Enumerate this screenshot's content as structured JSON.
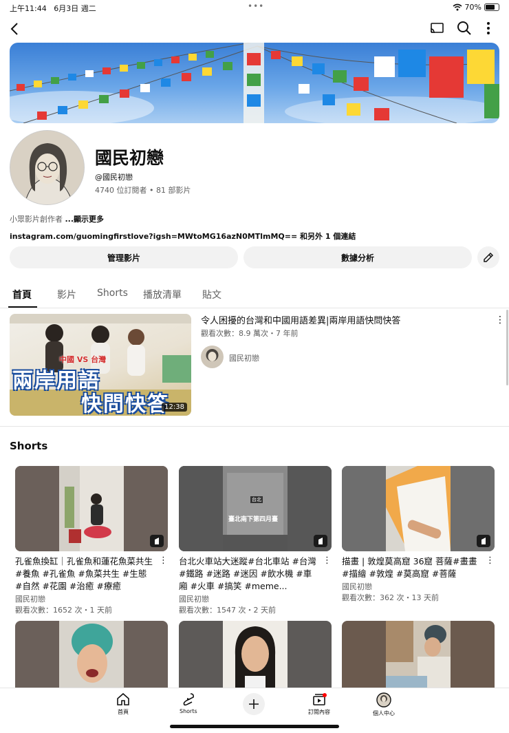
{
  "status": {
    "time": "上午11:44",
    "date": "6月3日 週二",
    "dots": "•••",
    "battery": "70%",
    "battery_level": 0.7
  },
  "channel": {
    "name": "國民初戀",
    "handle": "@國民初戀",
    "stats": "4740 位訂閱者 • 81 部影片",
    "description": "小眾影片創作者",
    "show_more": "...顯示更多",
    "link": "instagram.com/guomingfirstlove?igsh=MWtoMG16azN0MTlmMQ== 和另外 1 個連結"
  },
  "buttons": {
    "manage": "管理影片",
    "analytics": "數據分析"
  },
  "tabs": [
    "首頁",
    "影片",
    "Shorts",
    "播放清單",
    "貼文"
  ],
  "featured": {
    "title": "令人困擾的台灣和中國用語差異|兩岸用語快問快答",
    "meta": "觀看次數：8.9 萬次・7 年前",
    "channel": "國民初戀",
    "duration": "12:38",
    "thumb_text_top": "中國 VS 台灣",
    "thumb_text_1": "兩岸用語",
    "thumb_text_2": "快問快答"
  },
  "shorts": {
    "heading": "Shorts",
    "items": [
      {
        "title": "孔雀魚換缸｜孔雀魚和蓮花魚菜共生#養魚 #孔雀魚 #魚菜共生 #生態 #自然 #花園 #治癒 #療癒",
        "channel": "國民初戀",
        "meta": "觀看次數：1652 次・1 天前"
      },
      {
        "title": "台北火車站大迷蹤#台北車站 #台灣 #鐵路 #迷路 #迷因 #飲水機 #車廂 #火車 #搞笑 #meme...",
        "channel": "國民初戀",
        "meta": "觀看次數：1547 次・2 天前",
        "overlay_small": "台北",
        "overlay": "臺北南下第四月臺"
      },
      {
        "title": "描畫 | 敦煌莫高窟 36窟 菩薩#畫畫 #描繪 #敦煌 #莫高窟 #菩薩",
        "channel": "國民初戀",
        "meta": "觀看次數：362 次・13 天前"
      }
    ]
  },
  "bottom_nav": {
    "home": "首頁",
    "shorts": "Shorts",
    "subscriptions": "訂閱內容",
    "you": "個人中心"
  },
  "colors": {
    "accent": "#0f0f0f",
    "secondary_text": "#606060",
    "chip_bg": "#f2f2f2",
    "notification": "#ff0000"
  }
}
